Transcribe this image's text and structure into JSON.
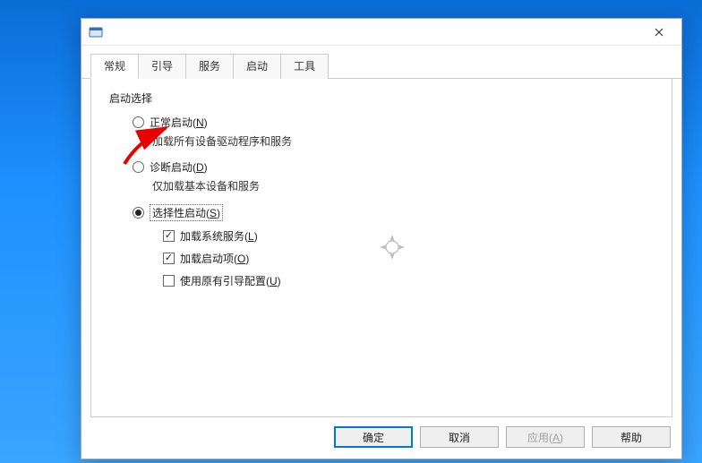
{
  "tabs": {
    "general": "常规",
    "boot": "引导",
    "services": "服务",
    "startup": "启动",
    "tools": "工具"
  },
  "panel": {
    "group_title": "启动选择",
    "normal": {
      "label_pre": "正常启动(",
      "hotkey": "N",
      "label_post": ")",
      "sub": "加载所有设备驱动程序和服务"
    },
    "diag": {
      "label_pre": "诊断启动(",
      "hotkey": "D",
      "label_post": ")",
      "sub": "仅加载基本设备和服务"
    },
    "selective": {
      "label_pre": "选择性启动(",
      "hotkey": "S",
      "label_post": ")"
    },
    "cb_services": {
      "pre": "加载系统服务(",
      "hotkey": "L",
      "post": ")"
    },
    "cb_startup": {
      "pre": "加载启动项(",
      "hotkey": "O",
      "post": ")"
    },
    "cb_origboot": {
      "pre": "使用原有引导配置(",
      "hotkey": "U",
      "post": ")"
    }
  },
  "buttons": {
    "ok": "确定",
    "cancel": "取消",
    "apply_pre": "应用(",
    "apply_hotkey": "A",
    "apply_post": ")",
    "help": "帮助"
  }
}
